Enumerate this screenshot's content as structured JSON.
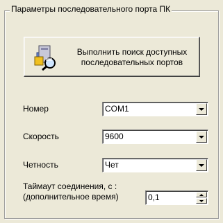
{
  "group": {
    "title": "Параметры последовательного порта ПК"
  },
  "search_button": {
    "line1": "Выполнить поиск доступных",
    "line2": "последовательных портов",
    "icon": "computer-search-icon"
  },
  "fields": {
    "number": {
      "label": "Номер",
      "value": "COM1"
    },
    "speed": {
      "label": "Скорость",
      "value": "9600"
    },
    "parity": {
      "label": "Четность",
      "value": "Чет"
    },
    "timeout": {
      "label_line1": "Таймаут соединения, с :",
      "label_line2": "(дополнительное время)",
      "value": "0,1"
    }
  },
  "colors": {
    "background": "#ece9d8",
    "field": "#ffffff"
  }
}
